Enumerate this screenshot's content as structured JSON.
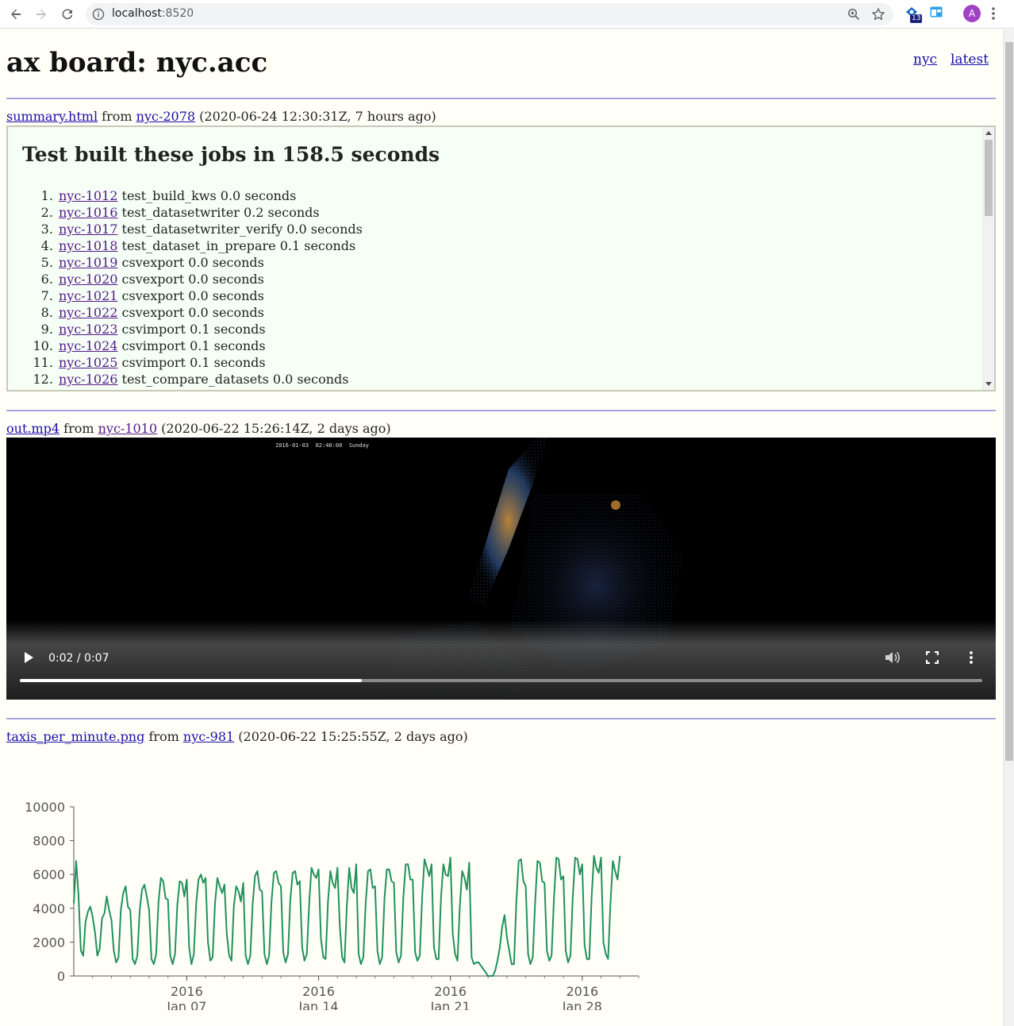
{
  "browser": {
    "url_host": "localhost",
    "url_port": ":8520",
    "extension_badge": "13",
    "avatar_letter": "A"
  },
  "page": {
    "title": "ax board: nyc.acc",
    "links": [
      "nyc",
      "latest"
    ]
  },
  "summary": {
    "file": "summary.html",
    "from_word": "from",
    "job": "nyc-2078",
    "time": "(2020-06-24 12:30:31Z, 7 hours ago)",
    "heading": "Test built these jobs in 158.5 seconds",
    "items": [
      {
        "job": "nyc-1012",
        "text": "test_build_kws 0.0 seconds"
      },
      {
        "job": "nyc-1016",
        "text": "test_datasetwriter 0.2 seconds"
      },
      {
        "job": "nyc-1017",
        "text": "test_datasetwriter_verify 0.0 seconds"
      },
      {
        "job": "nyc-1018",
        "text": "test_dataset_in_prepare 0.1 seconds"
      },
      {
        "job": "nyc-1019",
        "text": "csvexport 0.0 seconds"
      },
      {
        "job": "nyc-1020",
        "text": "csvexport 0.0 seconds"
      },
      {
        "job": "nyc-1021",
        "text": "csvexport 0.0 seconds"
      },
      {
        "job": "nyc-1022",
        "text": "csvexport 0.0 seconds"
      },
      {
        "job": "nyc-1023",
        "text": "csvimport 0.1 seconds"
      },
      {
        "job": "nyc-1024",
        "text": "csvimport 0.1 seconds"
      },
      {
        "job": "nyc-1025",
        "text": "csvimport 0.1 seconds"
      },
      {
        "job": "nyc-1026",
        "text": "test_compare_datasets 0.0 seconds"
      }
    ]
  },
  "video": {
    "file": "out.mp4",
    "from_word": "from",
    "job": "nyc-1010",
    "time": "(2020-06-22 15:26:14Z, 2 days ago)",
    "frame_stamp": "2016-01-03  02:40:00  Sunday",
    "time_display": "0:02 / 0:07",
    "progress": 0.355
  },
  "image": {
    "file": "taxis_per_minute.png",
    "from_word": "from",
    "job": "nyc-981",
    "time": "(2020-06-22 15:25:55Z, 2 days ago)"
  },
  "colors": {
    "line": "#22915a",
    "link": "#1a0dab",
    "visited": "#551a8b",
    "rule": "#a4a4e0"
  },
  "chart_data": {
    "type": "line",
    "title": "",
    "xlabel": "",
    "ylabel": "",
    "ylim": [
      0,
      10000
    ],
    "yticks": [
      "0",
      "2000",
      "4000",
      "6000",
      "8000",
      "10000"
    ],
    "xticks": [
      {
        "year": "2016",
        "date": "Jan 07",
        "day": 7
      },
      {
        "year": "2016",
        "date": "Jan 14",
        "day": 14
      },
      {
        "year": "2016",
        "date": "Jan 21",
        "day": 21
      },
      {
        "year": "2016",
        "date": "Jan 28",
        "day": 28
      }
    ],
    "xlim_days": [
      1,
      31
    ],
    "series": [
      {
        "x_start_day": 1,
        "step_hours": 3,
        "values": [
          4300,
          6800,
          4800,
          1500,
          1200,
          3200,
          3800,
          4100,
          3500,
          2600,
          1200,
          1600,
          3400,
          3700,
          4700,
          3900,
          3300,
          1500,
          800,
          1100,
          3900,
          4900,
          5300,
          4100,
          3900,
          1000,
          700,
          1200,
          3900,
          5100,
          5400,
          4700,
          3900,
          1000,
          700,
          1300,
          4400,
          5800,
          5600,
          4600,
          4500,
          1200,
          700,
          1300,
          4200,
          5600,
          5500,
          4700,
          5700,
          1700,
          700,
          1300,
          4300,
          5700,
          6000,
          5500,
          5800,
          2000,
          900,
          1100,
          4300,
          5800,
          5300,
          4900,
          5400,
          2500,
          1200,
          900,
          4100,
          5300,
          5000,
          4400,
          5500,
          1200,
          700,
          1200,
          4300,
          5900,
          6200,
          5100,
          5000,
          1300,
          700,
          1200,
          4400,
          6100,
          6200,
          5500,
          5300,
          1400,
          800,
          1300,
          4500,
          6100,
          6200,
          5400,
          5600,
          1700,
          900,
          1300,
          4300,
          6400,
          6000,
          5800,
          6300,
          2200,
          1100,
          1000,
          4400,
          6200,
          5500,
          5200,
          6400,
          3000,
          1100,
          800,
          4100,
          6400,
          5200,
          4900,
          6600,
          1300,
          700,
          1100,
          4300,
          6200,
          6300,
          5200,
          5300,
          1500,
          700,
          1100,
          4600,
          6300,
          6300,
          5600,
          5500,
          1400,
          800,
          1200,
          4600,
          6600,
          6600,
          5700,
          5700,
          1400,
          900,
          1200,
          4700,
          6900,
          6400,
          5900,
          6600,
          1700,
          1000,
          1000,
          4600,
          6600,
          6000,
          5900,
          7000,
          2500,
          1300,
          900,
          4100,
          6200,
          5800,
          5100,
          6700,
          1100,
          700,
          800,
          800,
          600,
          400,
          200,
          0,
          0,
          0,
          300,
          900,
          1700,
          2900,
          3600,
          2300,
          1500,
          700,
          700,
          4300,
          6800,
          6900,
          5600,
          5300,
          1300,
          700,
          1100,
          4400,
          6800,
          6700,
          5600,
          5500,
          1500,
          900,
          1200,
          4600,
          7000,
          6900,
          5700,
          5900,
          1500,
          800,
          1200,
          4700,
          7000,
          6900,
          6000,
          6600,
          1800,
          1000,
          1000,
          4700,
          7100,
          6400,
          6100,
          7000,
          2000,
          1300,
          1000,
          4300,
          6800,
          6200,
          5700,
          7100
        ]
      }
    ]
  }
}
